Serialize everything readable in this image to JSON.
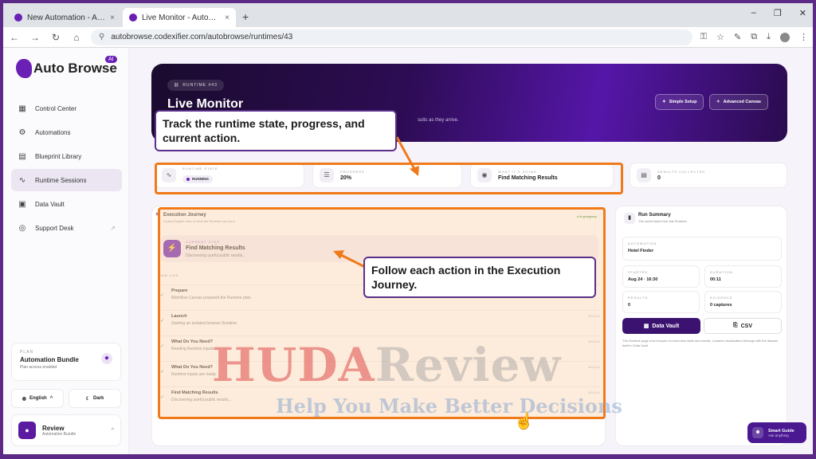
{
  "browser": {
    "tabs": [
      {
        "title": "New Automation - AutoBrowse",
        "close": "×"
      },
      {
        "title": "Live Monitor - AutoBrowse AI",
        "close": "×"
      }
    ],
    "new_tab": "+",
    "window_controls": {
      "minimize": "–",
      "restore": "❐",
      "close": "✕"
    },
    "nav": {
      "back": "←",
      "forward": "→",
      "reload": "↻",
      "home": "⌂"
    },
    "url": "autobrowse.codexifier.com/autobrowse/runtimes/43",
    "toolbar_icons": {
      "key": "⚿",
      "star": "☆",
      "pen": "✎",
      "extensions": "⧉",
      "download": "⤓",
      "menu": "⋮"
    }
  },
  "sidebar": {
    "brand": "Auto Browse",
    "brand_badge": "AI",
    "items": [
      {
        "label": "Control Center",
        "icon": "▦",
        "active": false
      },
      {
        "label": "Automations",
        "icon": "⚙",
        "active": false
      },
      {
        "label": "Blueprint Library",
        "icon": "▤",
        "active": false
      },
      {
        "label": "Runtime Sessions",
        "icon": "∿",
        "active": true
      },
      {
        "label": "Data Vault",
        "icon": "▣",
        "active": false
      },
      {
        "label": "Support Desk",
        "icon": "◎",
        "active": false,
        "external": "↗"
      }
    ],
    "plan": {
      "label": "PLAN",
      "name": "Automation Bundle",
      "sub": "Plan access enabled",
      "icon": "◆"
    },
    "language": {
      "label": "English",
      "icon": "◍",
      "chev": "^"
    },
    "theme": {
      "label": "Dark",
      "icon": "☾"
    },
    "user": {
      "name": "Review",
      "role": "Automation Bundle",
      "initial": "●",
      "chev": "^"
    }
  },
  "hero": {
    "chip": "RUNTIME #43",
    "title": "Live Monitor",
    "description": "sults as they arrive.",
    "buttons": [
      {
        "label": "Simple Setup",
        "icon": "✦"
      },
      {
        "label": "Advanced Canvas",
        "icon": "✧"
      }
    ]
  },
  "stats": {
    "runtime_state": {
      "label": "RUNTIME STATE",
      "value": "RUNNING",
      "icon": "∿"
    },
    "progress": {
      "label": "PROGRESS",
      "value": "20%",
      "fraction": 0.2,
      "icon": "☰"
    },
    "doing": {
      "label": "WHAT IT'S DOING",
      "value": "Find Matching Results",
      "icon": "◉"
    },
    "results": {
      "label": "RESULTS COLLECTED",
      "value": "0",
      "icon": "▤"
    }
  },
  "journey": {
    "title": "Execution Journey",
    "subtitle": "A plain-English view of what the Runtime has done.",
    "status": "● In progress",
    "icon": "≋",
    "current_step": {
      "label": "CURRENT STEP",
      "title": "Find Matching Results",
      "detail": "Discovering useful public results...",
      "icon": "⚡"
    },
    "run_log_label": "RUN LOG",
    "log": [
      {
        "title": "Prepare",
        "detail": "Workflow Canvas prepared the Runtime plan.",
        "time": ""
      },
      {
        "title": "Launch",
        "detail": "Starting an isolated browser Runtime.",
        "time": "00:00:11"
      },
      {
        "title": "What Do You Need?",
        "detail": "Reading Runtime inputs...",
        "time": "00:00:11"
      },
      {
        "title": "What Do You Need?",
        "detail": "Runtime inputs are ready.",
        "time": "00:00:11"
      },
      {
        "title": "Find Matching Results",
        "detail": "Discovering useful public results...",
        "time": "00:00:11"
      }
    ],
    "check": "✓"
  },
  "summary": {
    "title": "Run Summary",
    "subtitle": "The useful facts from this Runtime.",
    "icon": "▮",
    "automation": {
      "label": "AUTOMATION",
      "value": "Hotel Finder"
    },
    "started": {
      "label": "STARTED",
      "value": "Aug 24 · 16:30"
    },
    "duration": {
      "label": "DURATION",
      "value": "00:11"
    },
    "results": {
      "label": "RESULTS",
      "value": "0"
    },
    "evidence": {
      "label": "EVIDENCE",
      "value": "0 captures"
    },
    "data_vault_button": "Data Vault",
    "data_vault_icon": "▦",
    "csv_button": "CSV",
    "csv_icon": "⎘",
    "note": "The Runtime page now focuses on execution state and results. Location visualization belongs with the dataset itself in Data Vault."
  },
  "smart_guide": {
    "title": "Smart Guide",
    "sub": "Ask anything",
    "icon": "☻"
  },
  "annotations": {
    "callout_top": "Track the runtime state, progress, and current action.",
    "callout_mid": "Follow each action in the Execution Journey."
  },
  "watermark": {
    "part1": "HUDA",
    "part2": "Review",
    "tagline": "Help You Make Better Decisions"
  },
  "colors": {
    "brand": "#6a1fb5",
    "highlight": "#f07a1a",
    "callout_border": "#5a2f8a"
  }
}
